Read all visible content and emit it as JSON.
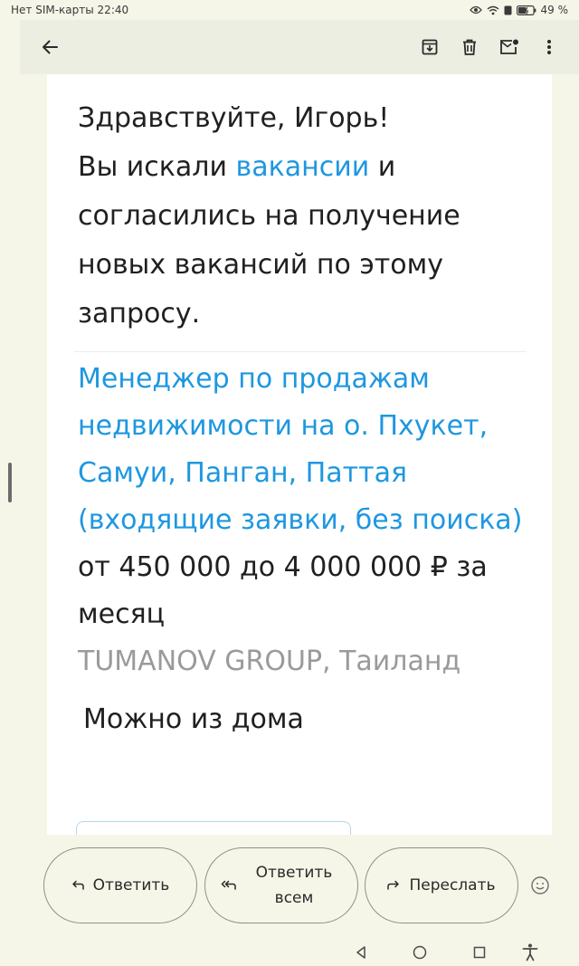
{
  "status_bar": {
    "left_text": "Нет SIM-карты 22:40",
    "battery_percent": "49 %"
  },
  "app_bar": {
    "back_icon": "arrow-left-icon",
    "actions": [
      "archive-icon",
      "trash-icon",
      "mark-unread-icon",
      "more-vert-icon"
    ]
  },
  "email": {
    "greeting": "Здравствуйте, Игорь!",
    "intro_before": "Вы искали ",
    "intro_link": "вакансии",
    "intro_after": " и согласились на получение новых вакансий по этому запросу.",
    "vacancy": {
      "title": "Менеджер по продажам недвижимости на о. Пхукет, Самуи, Панган, Паттая (входящие заявки, без поиска)",
      "salary": "от 450 000 до 4 000 000 ₽ за месяц",
      "company": "TUMANOV GROUP, Таиланд",
      "remote": "Можно из дома"
    }
  },
  "reply_bar": {
    "reply_label": "Ответить",
    "reply_all_label": "Ответить всем",
    "forward_label": "Переслать"
  },
  "colors": {
    "link": "#1e97e0",
    "company_gray": "#9a9a9a",
    "background": "#f5f6e8"
  }
}
